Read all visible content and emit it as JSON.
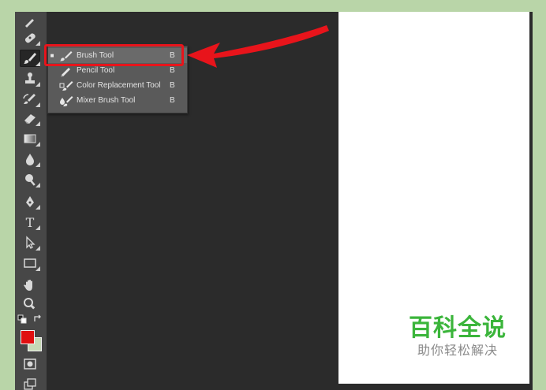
{
  "tools_menu": {
    "items": [
      {
        "label": "Brush Tool",
        "shortcut": "B",
        "selected": true,
        "marker": "■",
        "icon": "brush-icon"
      },
      {
        "label": "Pencil Tool",
        "shortcut": "B",
        "selected": false,
        "marker": "",
        "icon": "pencil-icon"
      },
      {
        "label": "Color Replacement Tool",
        "shortcut": "B",
        "selected": false,
        "marker": "",
        "icon": "color-replacement-icon"
      },
      {
        "label": "Mixer Brush Tool",
        "shortcut": "B",
        "selected": false,
        "marker": "",
        "icon": "mixer-brush-icon"
      }
    ]
  },
  "toolbar": {
    "tools": [
      {
        "name": "pen-edit-icon"
      },
      {
        "name": "healing-brush-icon"
      },
      {
        "name": "brush-icon",
        "active": true
      },
      {
        "name": "clone-stamp-icon"
      },
      {
        "name": "history-brush-icon"
      },
      {
        "name": "eraser-icon"
      },
      {
        "name": "gradient-icon"
      },
      {
        "name": "blur-drop-icon"
      },
      {
        "name": "dodge-icon"
      },
      {
        "name": "pen-tool-icon"
      },
      {
        "name": "type-tool-icon",
        "text": "T"
      },
      {
        "name": "path-selection-icon"
      },
      {
        "name": "rectangle-shape-icon"
      },
      {
        "name": "hand-tool-icon"
      },
      {
        "name": "zoom-tool-icon"
      }
    ],
    "foreground_color": "#e01010",
    "background_color": "#c6d8b6"
  },
  "colors": {
    "page_background": "#b9d5a8",
    "highlight": "#e8141b",
    "canvas": "#ffffff"
  },
  "watermark": {
    "title": "百科全说",
    "subtitle": "助你轻松解决"
  }
}
